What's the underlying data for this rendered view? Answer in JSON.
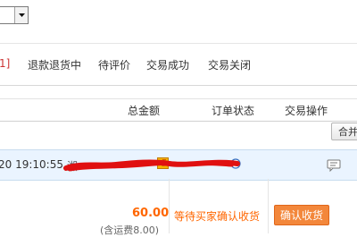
{
  "tabs": [
    {
      "label": "1]"
    },
    {
      "label": "退款退货中"
    },
    {
      "label": "待评价"
    },
    {
      "label": "交易成功"
    },
    {
      "label": "交易关闭"
    }
  ],
  "table_header": {
    "total_amount": "总金额",
    "order_status": "订单状态",
    "actions": "交易操作",
    "merge_button": "合并"
  },
  "order": {
    "datetime": "20 19:10:55",
    "seller_visible": "湘",
    "amount": "60.00",
    "shipping": "(含运费8.00)",
    "status": "等待买家确认收货",
    "confirm_button": "确认收货"
  },
  "colors": {
    "accent_orange": "#ff6600",
    "order_head_bg": "#eaf4ff",
    "confirm_button_bg": "#f3873b",
    "scribble_red": "#e01010"
  },
  "icons": [
    "chevron-down-icon",
    "wangwang-icon",
    "clock-icon",
    "message-icon"
  ]
}
